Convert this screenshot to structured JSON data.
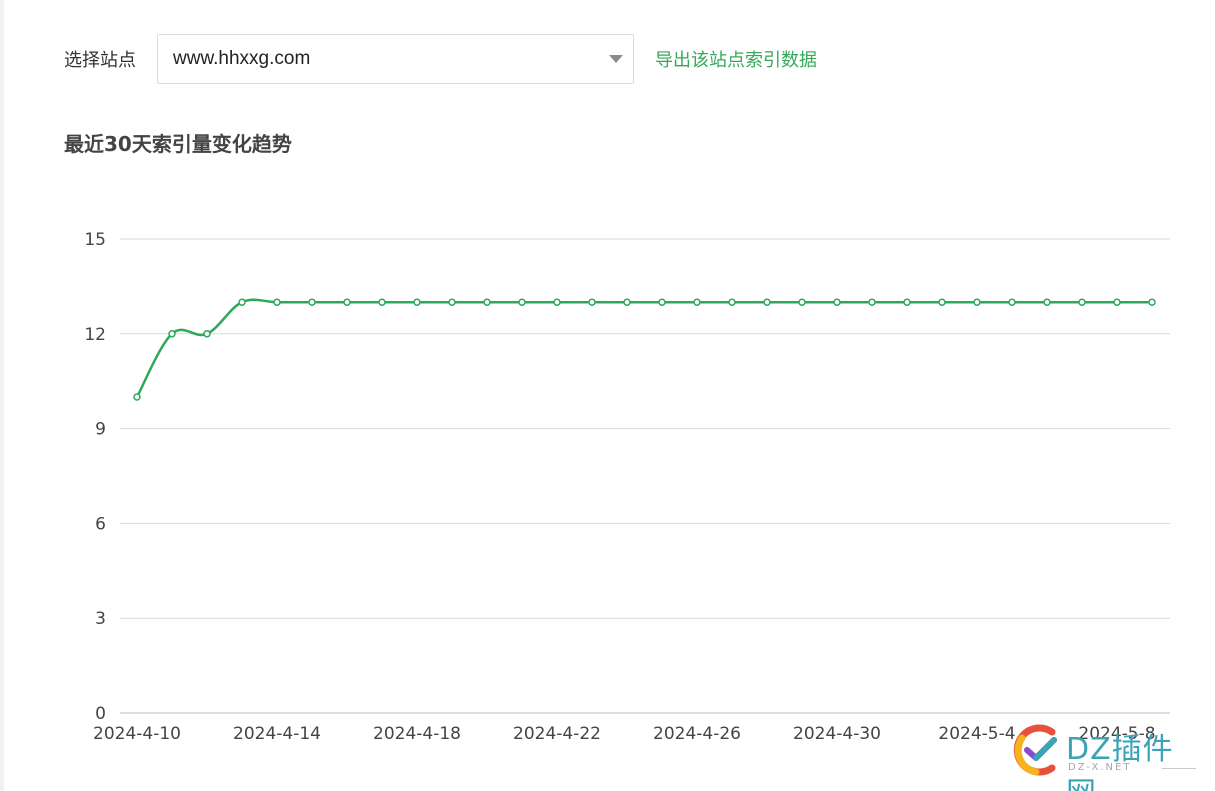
{
  "site_selector": {
    "label": "选择站点",
    "value": "www.hhxxg.com",
    "export_link": "导出该站点索引数据"
  },
  "chart_title": "最近30天索引量变化趋势",
  "chart_data": {
    "type": "line",
    "title": "最近30天索引量变化趋势",
    "xlabel": "",
    "ylabel": "",
    "ylim": [
      0,
      15
    ],
    "yticks": [
      0,
      3,
      6,
      9,
      12,
      15
    ],
    "x": [
      "2024-4-10",
      "2024-4-11",
      "2024-4-12",
      "2024-4-13",
      "2024-4-14",
      "2024-4-15",
      "2024-4-16",
      "2024-4-17",
      "2024-4-18",
      "2024-4-19",
      "2024-4-20",
      "2024-4-21",
      "2024-4-22",
      "2024-4-23",
      "2024-4-24",
      "2024-4-25",
      "2024-4-26",
      "2024-4-27",
      "2024-4-28",
      "2024-4-29",
      "2024-4-30",
      "2024-5-1",
      "2024-5-2",
      "2024-5-3",
      "2024-5-4",
      "2024-5-5",
      "2024-5-6",
      "2024-5-7",
      "2024-5-8",
      "2024-5-9"
    ],
    "xtick_labels": [
      "2024-4-10",
      "2024-4-14",
      "2024-4-18",
      "2024-4-22",
      "2024-4-26",
      "2024-4-30",
      "2024-5-4",
      "2024-5-8"
    ],
    "series": [
      {
        "values": [
          10,
          12,
          12,
          13,
          13,
          13,
          13,
          13,
          13,
          13,
          13,
          13,
          13,
          13,
          13,
          13,
          13,
          13,
          13,
          13,
          13,
          13,
          13,
          13,
          13,
          13,
          13,
          13,
          13,
          13
        ]
      }
    ],
    "grid": true,
    "line_color": "#2ea85a"
  },
  "watermark": {
    "text": "DZ插件网",
    "sub": "DZ-X.NET",
    "colors": [
      "#f6b31b",
      "#e84f3d",
      "#3aa3b8",
      "#8a4bd1"
    ]
  }
}
